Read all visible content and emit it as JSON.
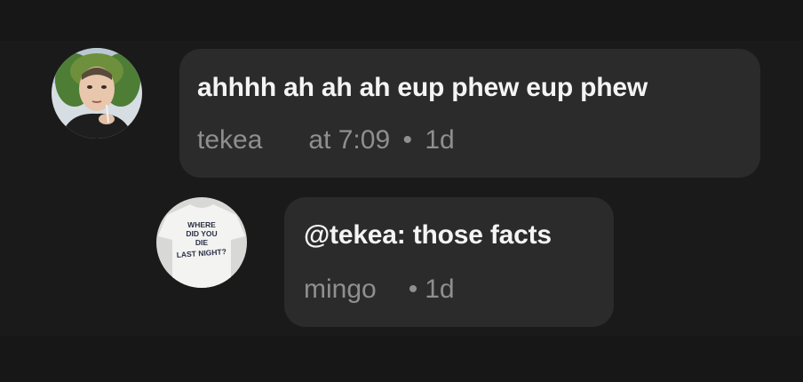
{
  "comments": [
    {
      "text": "ahhhh ah ah ah eup phew eup phew",
      "author": "tekea",
      "time": "at 7:09",
      "separator": "•",
      "age": "1d",
      "avatar_icon": "profile-photo-person-icon"
    },
    {
      "text": "@tekea: those facts",
      "author": "mingo",
      "time": "",
      "separator": "•",
      "age": "1d",
      "avatar_icon": "profile-photo-tshirt-icon",
      "avatar_text": "WHERE DID YOU DIE LAST NIGHT?"
    }
  ],
  "colors": {
    "background": "#1b1a1a",
    "bubble": "#2c2b2b",
    "message_text": "#f4f4f4",
    "meta_text": "#8f8f8f"
  }
}
